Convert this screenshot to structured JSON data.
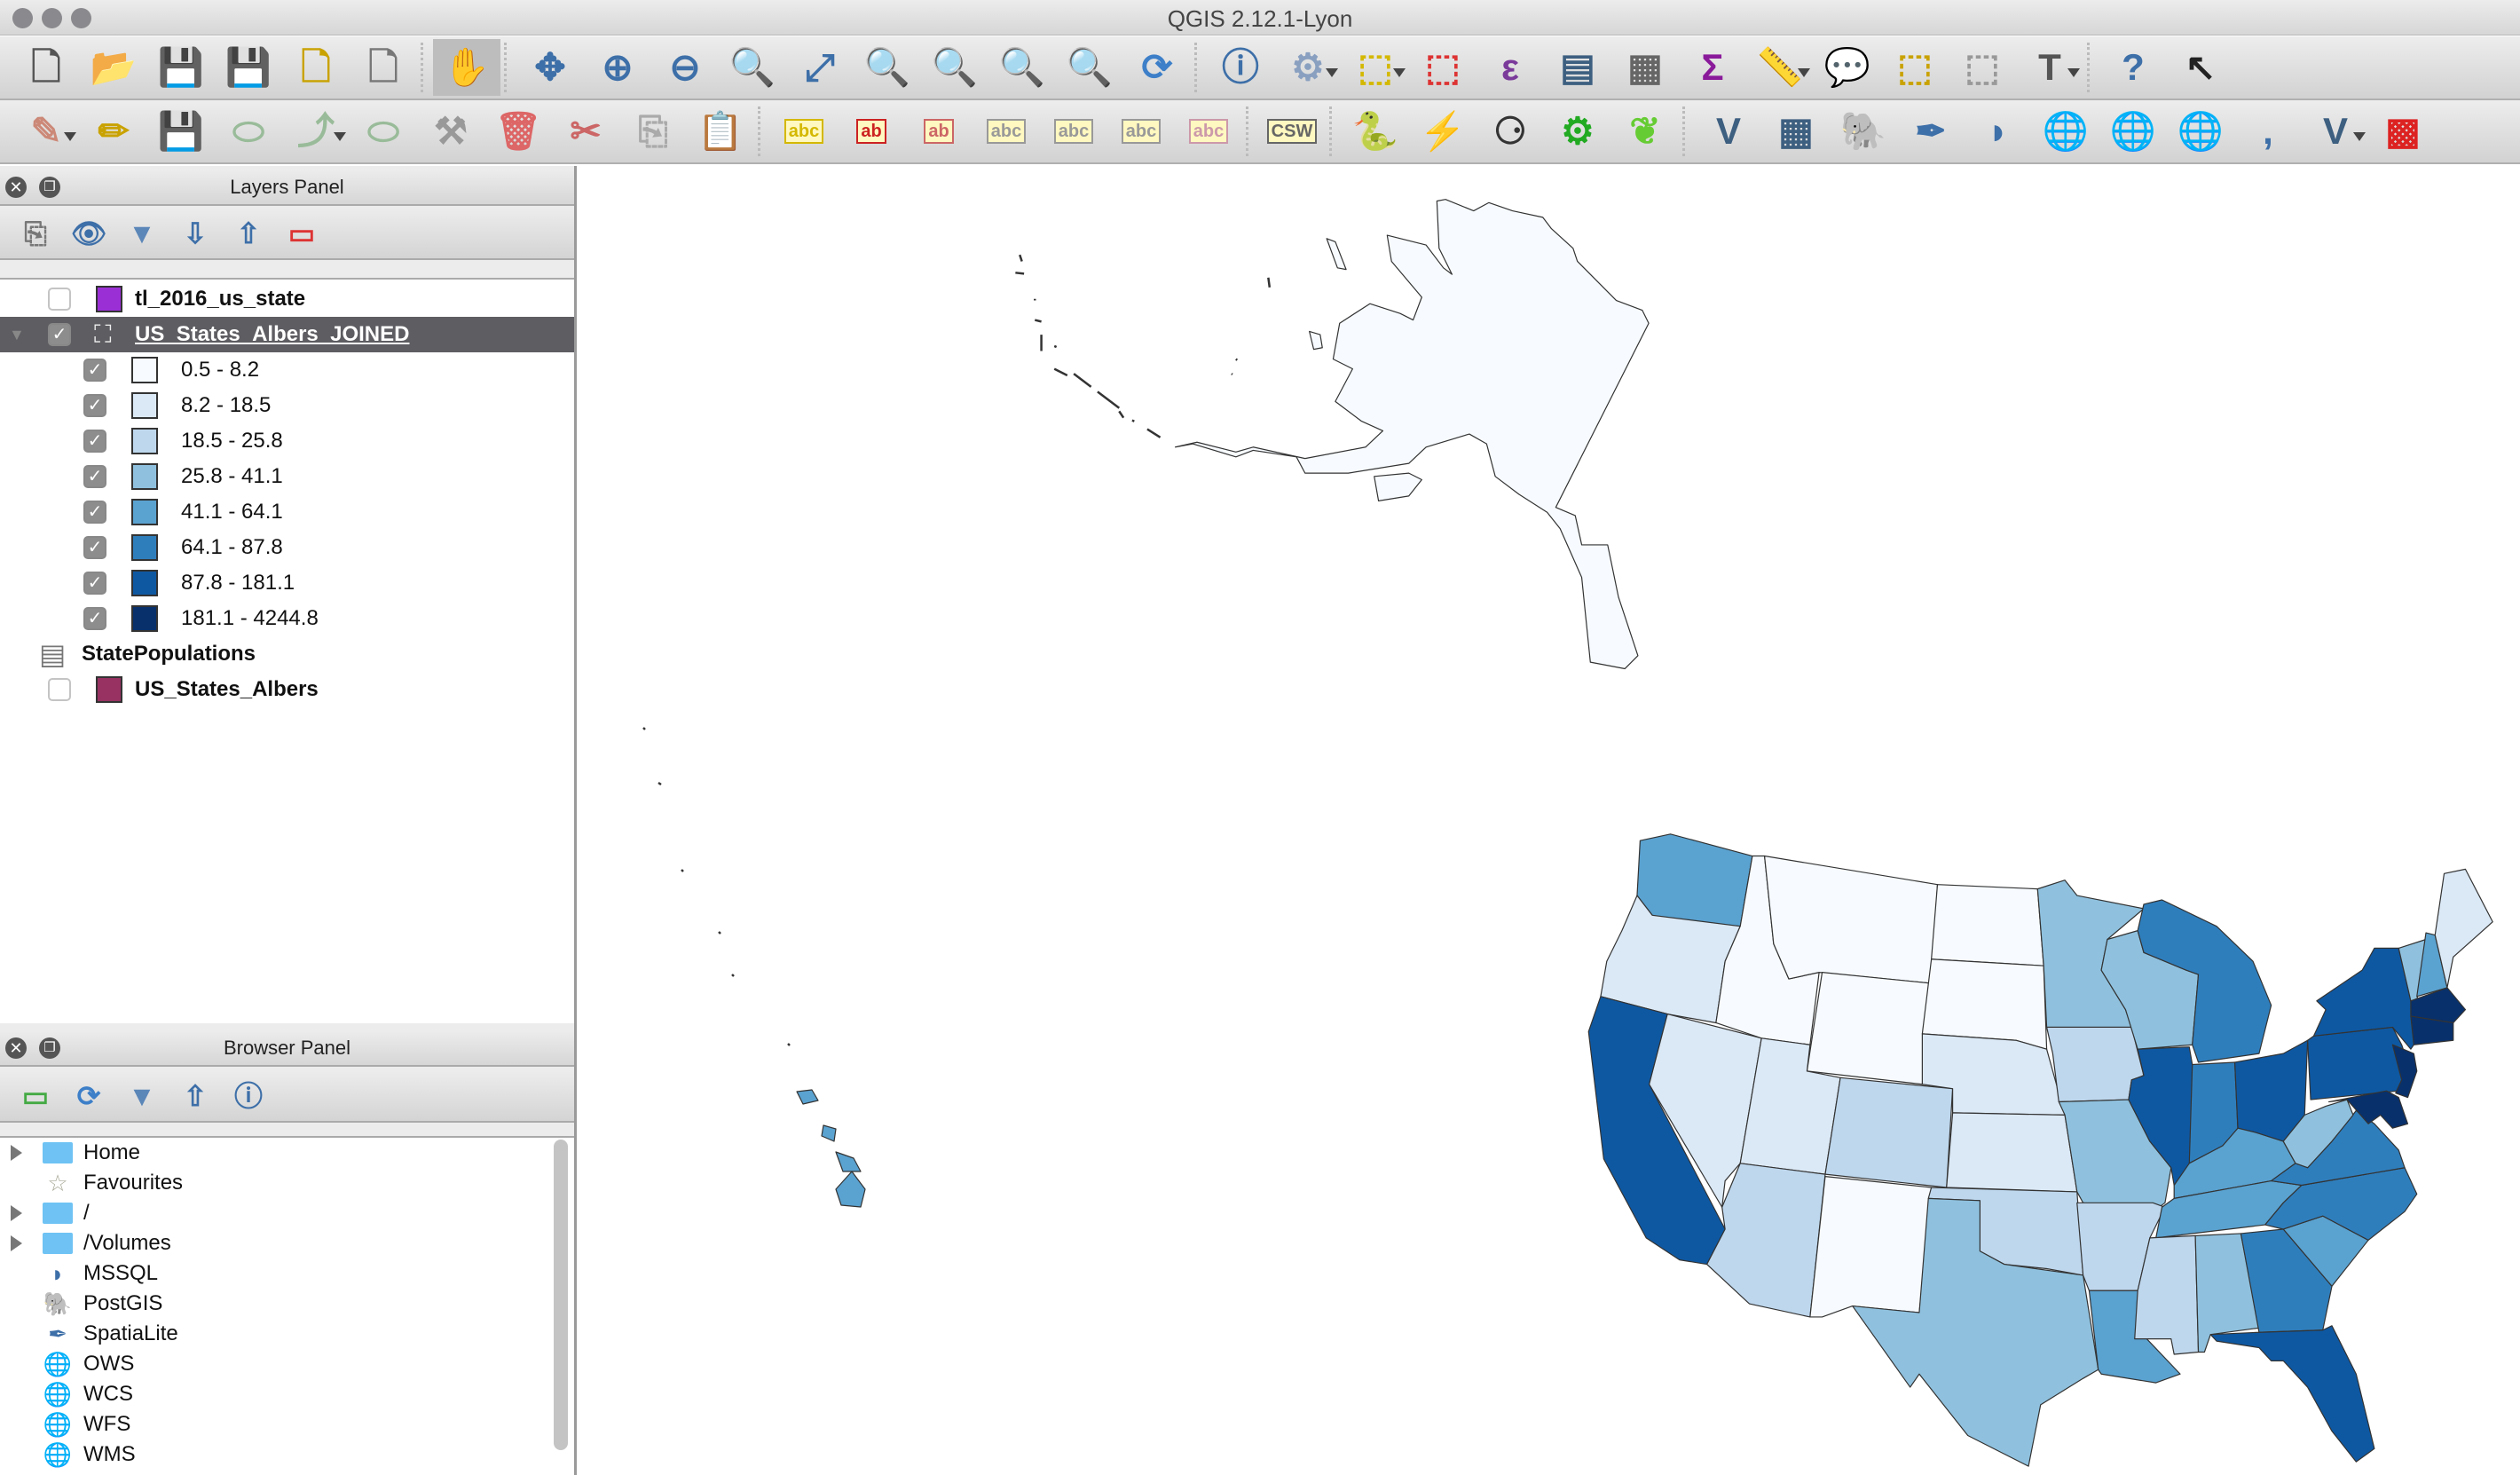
{
  "window": {
    "title": "QGIS 2.12.1-Lyon"
  },
  "toolbar1": [
    "new-project",
    "open-project",
    "save-project",
    "save-as",
    "new-print-composer",
    "composer-manager",
    "|",
    "pan-map",
    "|",
    "pan-to-selection",
    "zoom-in",
    "zoom-out",
    "zoom-native",
    "zoom-full",
    "zoom-to-selection",
    "zoom-to-layer",
    "zoom-last",
    "zoom-next",
    "refresh",
    "|",
    "identify",
    "action",
    "select-features",
    "deselect",
    "select-by-expression",
    "attribute-table",
    "field-calculator",
    "statistics",
    "measure",
    "map-tips",
    "new-bookmark",
    "show-bookmarks",
    "text-annotation",
    "|",
    "help",
    "whats-this"
  ],
  "toolbar2": [
    "current-edits",
    "toggle-editing",
    "save-edits",
    "add-feature",
    "add-part",
    "move-feature",
    "node-tool",
    "delete-selected",
    "cut-features",
    "copy-features",
    "paste-features",
    "|",
    "labeling",
    "layer-labeling",
    "pin-labels",
    "show-hide-labels",
    "move-label",
    "rotate-label",
    "change-label",
    "|",
    "csw",
    "|",
    "python",
    "plugin",
    "binoculars",
    "processing",
    "grass",
    "|",
    "add-vector",
    "add-raster",
    "add-postgis",
    "add-spatialite",
    "add-mssql",
    "add-wms",
    "add-wcs",
    "add-wfs",
    "add-delimited",
    "new-layer",
    "oracle"
  ],
  "layers_panel": {
    "title": "Layers Panel",
    "tools": [
      "add-group",
      "manage-visibility",
      "filter-legend",
      "expand-all",
      "collapse-all",
      "remove-layer"
    ],
    "layers": [
      {
        "name": "tl_2016_us_state",
        "checked": false,
        "color": "#9b2fd6"
      },
      {
        "name": "US_States_Albers_JOINED",
        "checked": true,
        "selected": true,
        "classes": [
          {
            "label": "0.5 - 8.2",
            "color": "#f7fbff"
          },
          {
            "label": "8.2 - 18.5",
            "color": "#dbe9f6"
          },
          {
            "label": "18.5 - 25.8",
            "color": "#bed7ed"
          },
          {
            "label": "25.8 - 41.1",
            "color": "#8fc1de"
          },
          {
            "label": "41.1 - 64.1",
            "color": "#5aa2d0"
          },
          {
            "label": "64.1 - 87.8",
            "color": "#2f7ebc"
          },
          {
            "label": "87.8 - 181.1",
            "color": "#0e58a2"
          },
          {
            "label": "181.1 - 4244.8",
            "color": "#08306b"
          }
        ]
      },
      {
        "name": "StatePopulations",
        "type": "table"
      },
      {
        "name": "US_States_Albers",
        "checked": false,
        "color": "#973262"
      }
    ]
  },
  "browser_panel": {
    "title": "Browser Panel",
    "tools": [
      "add-selected",
      "refresh",
      "filter",
      "collapse",
      "properties"
    ],
    "items": [
      {
        "label": "Home",
        "icon": "folder",
        "expandable": true
      },
      {
        "label": "Favourites",
        "icon": "star",
        "expandable": false
      },
      {
        "label": "/",
        "icon": "folder",
        "expandable": true
      },
      {
        "label": "/Volumes",
        "icon": "folder",
        "expandable": true
      },
      {
        "label": "MSSQL",
        "icon": "mssql",
        "expandable": false
      },
      {
        "label": "PostGIS",
        "icon": "postgis",
        "expandable": false
      },
      {
        "label": "SpatiaLite",
        "icon": "spatialite",
        "expandable": false
      },
      {
        "label": "OWS",
        "icon": "ows",
        "expandable": false
      },
      {
        "label": "WCS",
        "icon": "wcs",
        "expandable": false
      },
      {
        "label": "WFS",
        "icon": "wfs",
        "expandable": false
      },
      {
        "label": "WMS",
        "icon": "wms",
        "expandable": false
      }
    ]
  }
}
